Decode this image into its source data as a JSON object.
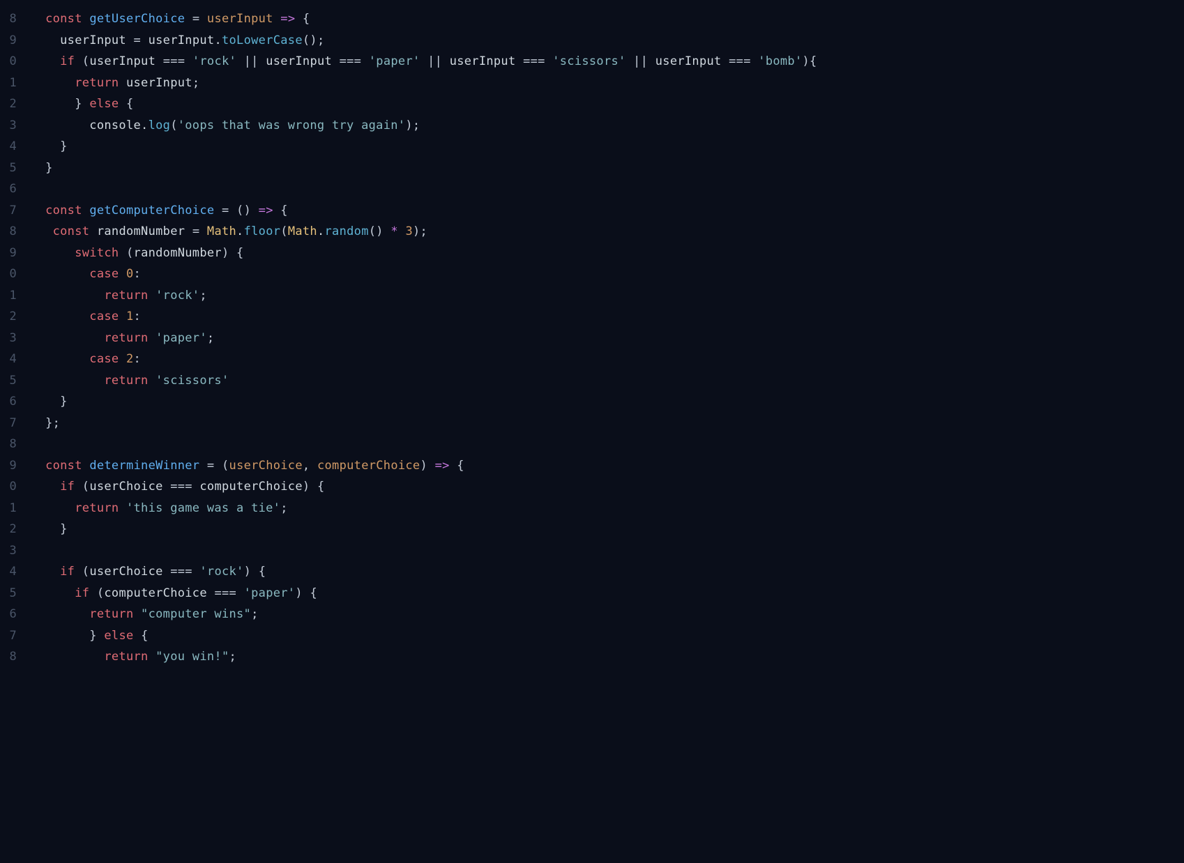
{
  "gutter_start_digit": "8",
  "gutter_digits": [
    "8",
    "9",
    "0",
    "1",
    "2",
    "3",
    "4",
    "5",
    "6",
    "7",
    "8",
    "9",
    "0",
    "1",
    "2",
    "3",
    "4",
    "5",
    "6",
    "7",
    "8",
    "9",
    "0",
    "1",
    "2",
    "3",
    "4",
    "5",
    "6",
    "7",
    "8"
  ],
  "code": {
    "lines": [
      {
        "indent": "  ",
        "tokens": [
          [
            "kw",
            "const"
          ],
          [
            "sp",
            " "
          ],
          [
            "fn",
            "getUserChoice"
          ],
          [
            "sp",
            " "
          ],
          [
            "op",
            "="
          ],
          [
            "sp",
            " "
          ],
          [
            "param",
            "userInput"
          ],
          [
            "sp",
            " "
          ],
          [
            "arrow",
            "=>"
          ],
          [
            "sp",
            " "
          ],
          [
            "op",
            "{"
          ]
        ]
      },
      {
        "indent": "    ",
        "tokens": [
          [
            "id",
            "userInput"
          ],
          [
            "sp",
            " "
          ],
          [
            "op",
            "="
          ],
          [
            "sp",
            " "
          ],
          [
            "id",
            "userInput"
          ],
          [
            "dot",
            "."
          ],
          [
            "meth",
            "toLowerCase"
          ],
          [
            "op",
            "()"
          ],
          [
            "op",
            ";"
          ]
        ]
      },
      {
        "indent": "    ",
        "tokens": [
          [
            "kw",
            "if"
          ],
          [
            "sp",
            " "
          ],
          [
            "op",
            "("
          ],
          [
            "id",
            "userInput"
          ],
          [
            "sp",
            " "
          ],
          [
            "op",
            "==="
          ],
          [
            "sp",
            " "
          ],
          [
            "str",
            "'rock'"
          ],
          [
            "sp",
            " "
          ],
          [
            "op",
            "||"
          ],
          [
            "sp",
            " "
          ],
          [
            "id",
            "userInput"
          ],
          [
            "sp",
            " "
          ],
          [
            "op",
            "==="
          ],
          [
            "sp",
            " "
          ],
          [
            "str",
            "'paper'"
          ],
          [
            "sp",
            " "
          ],
          [
            "op",
            "||"
          ],
          [
            "sp",
            " "
          ],
          [
            "id",
            "userInput"
          ],
          [
            "sp",
            " "
          ],
          [
            "op",
            "==="
          ],
          [
            "sp",
            " "
          ],
          [
            "str",
            "'scissors'"
          ],
          [
            "sp",
            " "
          ],
          [
            "op",
            "||"
          ],
          [
            "sp",
            " "
          ],
          [
            "id",
            "userInput"
          ],
          [
            "sp",
            " "
          ],
          [
            "op",
            "==="
          ],
          [
            "sp",
            " "
          ],
          [
            "str",
            "'bomb'"
          ],
          [
            "op",
            ")"
          ],
          [
            "op",
            "{"
          ]
        ]
      },
      {
        "indent": "      ",
        "tokens": [
          [
            "kw",
            "return"
          ],
          [
            "sp",
            " "
          ],
          [
            "id",
            "userInput"
          ],
          [
            "op",
            ";"
          ]
        ]
      },
      {
        "indent": "      ",
        "tokens": [
          [
            "op",
            "}"
          ],
          [
            "sp",
            " "
          ],
          [
            "kw",
            "else"
          ],
          [
            "sp",
            " "
          ],
          [
            "op",
            "{"
          ]
        ]
      },
      {
        "indent": "        ",
        "tokens": [
          [
            "id",
            "console"
          ],
          [
            "dot",
            "."
          ],
          [
            "meth",
            "log"
          ],
          [
            "op",
            "("
          ],
          [
            "str",
            "'oops that was wrong try again'"
          ],
          [
            "op",
            ")"
          ],
          [
            "op",
            ";"
          ]
        ]
      },
      {
        "indent": "    ",
        "tokens": [
          [
            "op",
            "}"
          ]
        ]
      },
      {
        "indent": "  ",
        "tokens": [
          [
            "op",
            "}"
          ]
        ]
      },
      {
        "indent": "",
        "tokens": []
      },
      {
        "indent": "  ",
        "tokens": [
          [
            "kw",
            "const"
          ],
          [
            "sp",
            " "
          ],
          [
            "fn",
            "getComputerChoice"
          ],
          [
            "sp",
            " "
          ],
          [
            "op",
            "="
          ],
          [
            "sp",
            " "
          ],
          [
            "op",
            "()"
          ],
          [
            "sp",
            " "
          ],
          [
            "arrow",
            "=>"
          ],
          [
            "sp",
            " "
          ],
          [
            "op",
            "{"
          ]
        ]
      },
      {
        "indent": "   ",
        "tokens": [
          [
            "kw",
            "const"
          ],
          [
            "sp",
            " "
          ],
          [
            "id",
            "randomNumber"
          ],
          [
            "sp",
            " "
          ],
          [
            "op",
            "="
          ],
          [
            "sp",
            " "
          ],
          [
            "obj",
            "Math"
          ],
          [
            "dot",
            "."
          ],
          [
            "meth",
            "floor"
          ],
          [
            "op",
            "("
          ],
          [
            "obj",
            "Math"
          ],
          [
            "dot",
            "."
          ],
          [
            "meth",
            "random"
          ],
          [
            "op",
            "()"
          ],
          [
            "sp",
            " "
          ],
          [
            "star",
            "*"
          ],
          [
            "sp",
            " "
          ],
          [
            "num",
            "3"
          ],
          [
            "op",
            ")"
          ],
          [
            "op",
            ";"
          ]
        ]
      },
      {
        "indent": "      ",
        "tokens": [
          [
            "kw",
            "switch"
          ],
          [
            "sp",
            " "
          ],
          [
            "op",
            "("
          ],
          [
            "id",
            "randomNumber"
          ],
          [
            "op",
            ")"
          ],
          [
            "sp",
            " "
          ],
          [
            "op",
            "{"
          ]
        ]
      },
      {
        "indent": "        ",
        "tokens": [
          [
            "kw",
            "case"
          ],
          [
            "sp",
            " "
          ],
          [
            "num",
            "0"
          ],
          [
            "op",
            ":"
          ]
        ]
      },
      {
        "indent": "          ",
        "tokens": [
          [
            "kw",
            "return"
          ],
          [
            "sp",
            " "
          ],
          [
            "str",
            "'rock'"
          ],
          [
            "op",
            ";"
          ]
        ]
      },
      {
        "indent": "        ",
        "tokens": [
          [
            "kw",
            "case"
          ],
          [
            "sp",
            " "
          ],
          [
            "num",
            "1"
          ],
          [
            "op",
            ":"
          ]
        ]
      },
      {
        "indent": "          ",
        "tokens": [
          [
            "kw",
            "return"
          ],
          [
            "sp",
            " "
          ],
          [
            "str",
            "'paper'"
          ],
          [
            "op",
            ";"
          ]
        ]
      },
      {
        "indent": "        ",
        "tokens": [
          [
            "kw",
            "case"
          ],
          [
            "sp",
            " "
          ],
          [
            "num",
            "2"
          ],
          [
            "op",
            ":"
          ]
        ]
      },
      {
        "indent": "          ",
        "tokens": [
          [
            "kw",
            "return"
          ],
          [
            "sp",
            " "
          ],
          [
            "str",
            "'scissors'"
          ]
        ]
      },
      {
        "indent": "    ",
        "tokens": [
          [
            "op",
            "}"
          ]
        ]
      },
      {
        "indent": "  ",
        "tokens": [
          [
            "op",
            "}"
          ],
          [
            "op",
            ";"
          ]
        ]
      },
      {
        "indent": "",
        "tokens": []
      },
      {
        "indent": "  ",
        "tokens": [
          [
            "kw",
            "const"
          ],
          [
            "sp",
            " "
          ],
          [
            "fn",
            "determineWinner"
          ],
          [
            "sp",
            " "
          ],
          [
            "op",
            "="
          ],
          [
            "sp",
            " "
          ],
          [
            "op",
            "("
          ],
          [
            "param",
            "userChoice"
          ],
          [
            "op",
            ","
          ],
          [
            "sp",
            " "
          ],
          [
            "param",
            "computerChoice"
          ],
          [
            "op",
            ")"
          ],
          [
            "sp",
            " "
          ],
          [
            "arrow",
            "=>"
          ],
          [
            "sp",
            " "
          ],
          [
            "op",
            "{"
          ]
        ]
      },
      {
        "indent": "    ",
        "tokens": [
          [
            "kw",
            "if"
          ],
          [
            "sp",
            " "
          ],
          [
            "op",
            "("
          ],
          [
            "id",
            "userChoice"
          ],
          [
            "sp",
            " "
          ],
          [
            "op",
            "==="
          ],
          [
            "sp",
            " "
          ],
          [
            "id",
            "computerChoice"
          ],
          [
            "op",
            ")"
          ],
          [
            "sp",
            " "
          ],
          [
            "op",
            "{"
          ]
        ]
      },
      {
        "indent": "      ",
        "tokens": [
          [
            "kw",
            "return"
          ],
          [
            "sp",
            " "
          ],
          [
            "str",
            "'this game was a tie'"
          ],
          [
            "op",
            ";"
          ]
        ]
      },
      {
        "indent": "    ",
        "tokens": [
          [
            "op",
            "}"
          ]
        ]
      },
      {
        "indent": "",
        "tokens": []
      },
      {
        "indent": "    ",
        "tokens": [
          [
            "kw",
            "if"
          ],
          [
            "sp",
            " "
          ],
          [
            "op",
            "("
          ],
          [
            "id",
            "userChoice"
          ],
          [
            "sp",
            " "
          ],
          [
            "op",
            "==="
          ],
          [
            "sp",
            " "
          ],
          [
            "str",
            "'rock'"
          ],
          [
            "op",
            ")"
          ],
          [
            "sp",
            " "
          ],
          [
            "op",
            "{"
          ]
        ]
      },
      {
        "indent": "      ",
        "tokens": [
          [
            "kw",
            "if"
          ],
          [
            "sp",
            " "
          ],
          [
            "op",
            "("
          ],
          [
            "id",
            "computerChoice"
          ],
          [
            "sp",
            " "
          ],
          [
            "op",
            "==="
          ],
          [
            "sp",
            " "
          ],
          [
            "str",
            "'paper'"
          ],
          [
            "op",
            ")"
          ],
          [
            "sp",
            " "
          ],
          [
            "op",
            "{"
          ]
        ]
      },
      {
        "indent": "        ",
        "tokens": [
          [
            "kw",
            "return"
          ],
          [
            "sp",
            " "
          ],
          [
            "str",
            "\"computer wins\""
          ],
          [
            "op",
            ";"
          ]
        ]
      },
      {
        "indent": "        ",
        "tokens": [
          [
            "op",
            "}"
          ],
          [
            "sp",
            " "
          ],
          [
            "kw",
            "else"
          ],
          [
            "sp",
            " "
          ],
          [
            "op",
            "{"
          ]
        ]
      },
      {
        "indent": "          ",
        "tokens": [
          [
            "kw",
            "return"
          ],
          [
            "sp",
            " "
          ],
          [
            "str",
            "\"you win!\""
          ],
          [
            "op",
            ";"
          ]
        ]
      }
    ]
  }
}
